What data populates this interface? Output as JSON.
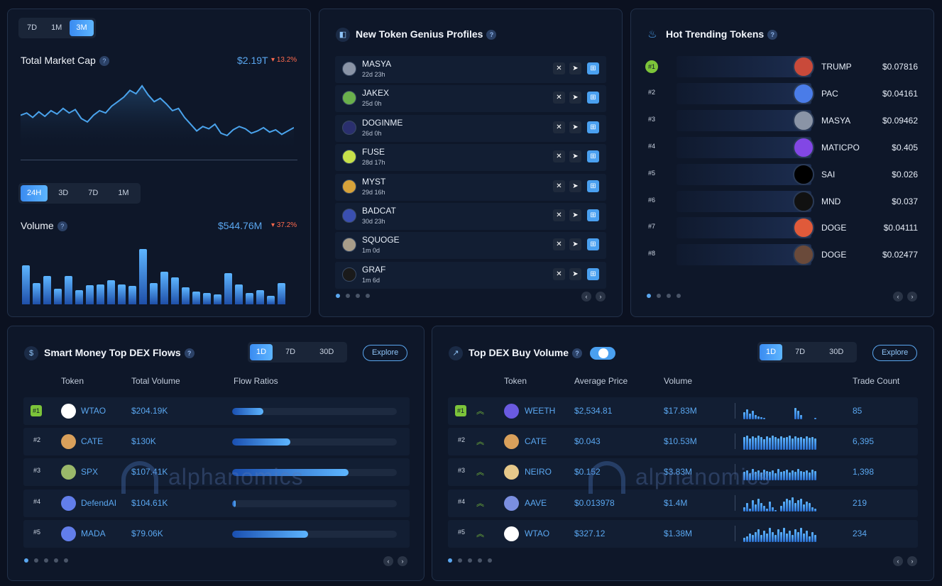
{
  "market": {
    "range_options": [
      "7D",
      "1M",
      "3M"
    ],
    "range_active": "3M",
    "cap_title": "Total Market Cap",
    "cap_value": "$2.19T",
    "cap_change": "13.2%",
    "cap_series": [
      58,
      60,
      56,
      61,
      57,
      62,
      59,
      64,
      60,
      63,
      55,
      52,
      58,
      62,
      60,
      66,
      70,
      74,
      80,
      77,
      84,
      76,
      70,
      73,
      68,
      62,
      64,
      56,
      50,
      44,
      48,
      46,
      50,
      42,
      40,
      45,
      48,
      46,
      42,
      44,
      47,
      43,
      45,
      41,
      44,
      47
    ],
    "volume_options": [
      "24H",
      "3D",
      "7D",
      "1M"
    ],
    "volume_active": "24H",
    "volume_title": "Volume",
    "volume_value": "$544.76M",
    "volume_change": "37.2%",
    "volume_bars": [
      55,
      30,
      40,
      22,
      40,
      20,
      27,
      28,
      34,
      28,
      26,
      78,
      30,
      46,
      38,
      24,
      18,
      16,
      14,
      44,
      28,
      16,
      20,
      12,
      30
    ]
  },
  "profiles": {
    "title": "New Token Genius Profiles",
    "rows": [
      {
        "name": "MASYA",
        "age": "22d 23h",
        "color": "#8a94a6"
      },
      {
        "name": "JAKEX",
        "age": "25d 0h",
        "color": "#6ab04c"
      },
      {
        "name": "DOGINME",
        "age": "26d 0h",
        "color": "#2a2f6e"
      },
      {
        "name": "FUSE",
        "age": "28d 17h",
        "color": "#c6e04a"
      },
      {
        "name": "MYST",
        "age": "29d 16h",
        "color": "#d6a23a"
      },
      {
        "name": "BADCAT",
        "age": "30d 23h",
        "color": "#3a4fb0"
      },
      {
        "name": "SQUOGE",
        "age": "1m 0d",
        "color": "#a89d8a"
      },
      {
        "name": "GRAF",
        "age": "1m 6d",
        "color": "#1a1a1a"
      }
    ]
  },
  "trending": {
    "title": "Hot Trending Tokens",
    "rows": [
      {
        "rank": "#1",
        "name": "TRUMP",
        "price": "$0.07816",
        "color": "#c94a3a"
      },
      {
        "rank": "#2",
        "name": "PAC",
        "price": "$0.04161",
        "color": "#4a7ce8"
      },
      {
        "rank": "#3",
        "name": "MASYA",
        "price": "$0.09462",
        "color": "#8a94a6"
      },
      {
        "rank": "#4",
        "name": "MATICPO",
        "price": "$0.405",
        "color": "#8247e5"
      },
      {
        "rank": "#5",
        "name": "SAI",
        "price": "$0.026",
        "color": "#000000"
      },
      {
        "rank": "#6",
        "name": "MND",
        "price": "$0.037",
        "color": "#111111"
      },
      {
        "rank": "#7",
        "name": "DOGE",
        "price": "$0.04111",
        "color": "#e05a3a"
      },
      {
        "rank": "#8",
        "name": "DOGE",
        "price": "$0.02477",
        "color": "#6a4a3a"
      }
    ]
  },
  "flows": {
    "title": "Smart Money Top DEX Flows",
    "range_options": [
      "1D",
      "7D",
      "30D"
    ],
    "range_active": "1D",
    "explore": "Explore",
    "headers": {
      "token": "Token",
      "volume": "Total Volume",
      "ratios": "Flow Ratios"
    },
    "rows": [
      {
        "rank": "#1",
        "token": "WTAO",
        "volume": "$204.19K",
        "ratio": 0.19,
        "color": "#ffffff"
      },
      {
        "rank": "#2",
        "token": "CATE",
        "volume": "$130K",
        "ratio": 0.355,
        "color": "#d9a05b"
      },
      {
        "rank": "#3",
        "token": "SPX",
        "volume": "$107.41K",
        "ratio": 0.705,
        "color": "#9ab86a"
      },
      {
        "rank": "#4",
        "token": "DefendAI",
        "volume": "$104.61K",
        "ratio": 0.02,
        "color": "#627eea"
      },
      {
        "rank": "#5",
        "token": "MADA",
        "volume": "$79.06K",
        "ratio": 0.46,
        "color": "#627eea"
      }
    ],
    "watermark": "alphanomics"
  },
  "dexbuy": {
    "title": "Top DEX Buy Volume",
    "range_options": [
      "1D",
      "7D",
      "30D"
    ],
    "range_active": "1D",
    "explore": "Explore",
    "headers": {
      "token": "Token",
      "avg_price": "Average Price",
      "volume": "Volume",
      "trades": "Trade Count"
    },
    "rows": [
      {
        "rank": "#1",
        "token": "WEETH",
        "price": "$2,534.81",
        "volume": "$17.83M",
        "trades": "85",
        "color": "#6a5ae0",
        "spark": [
          10,
          14,
          8,
          12,
          6,
          4,
          3,
          2,
          0,
          0,
          0,
          0,
          0,
          0,
          0,
          0,
          0,
          0,
          16,
          12,
          6,
          0,
          0,
          0,
          0,
          2
        ]
      },
      {
        "rank": "#2",
        "token": "CATE",
        "price": "$0.043",
        "volume": "$10.53M",
        "trades": "6,395",
        "color": "#d9a05b",
        "spark": [
          18,
          20,
          16,
          19,
          17,
          20,
          18,
          15,
          19,
          17,
          20,
          18,
          16,
          19,
          17,
          18,
          20,
          16,
          19,
          17,
          18,
          16,
          19,
          17,
          18,
          16
        ]
      },
      {
        "rank": "#3",
        "token": "NEIRO",
        "price": "$0.152",
        "volume": "$3.83M",
        "trades": "1,398",
        "color": "#e6c88a",
        "spark": [
          12,
          14,
          10,
          16,
          12,
          14,
          11,
          15,
          13,
          12,
          14,
          10,
          16,
          12,
          13,
          15,
          11,
          14,
          12,
          16,
          13,
          12,
          14,
          11,
          15,
          13
        ]
      },
      {
        "rank": "#4",
        "token": "AAVE",
        "price": "$0.013978",
        "volume": "$1.4M",
        "trades": "219",
        "color": "#7b8fe0",
        "spark": [
          6,
          12,
          4,
          16,
          10,
          18,
          12,
          8,
          4,
          14,
          6,
          2,
          0,
          8,
          14,
          18,
          16,
          20,
          12,
          16,
          18,
          10,
          14,
          12,
          6,
          4
        ]
      },
      {
        "rank": "#5",
        "token": "WTAO",
        "price": "$327.12",
        "volume": "$1.38M",
        "trades": "234",
        "color": "#ffffff",
        "spark": [
          6,
          8,
          12,
          10,
          14,
          18,
          10,
          16,
          12,
          20,
          14,
          10,
          18,
          14,
          20,
          12,
          16,
          10,
          18,
          14,
          20,
          12,
          16,
          8,
          14,
          10
        ]
      }
    ],
    "watermark": "alphanomics"
  }
}
